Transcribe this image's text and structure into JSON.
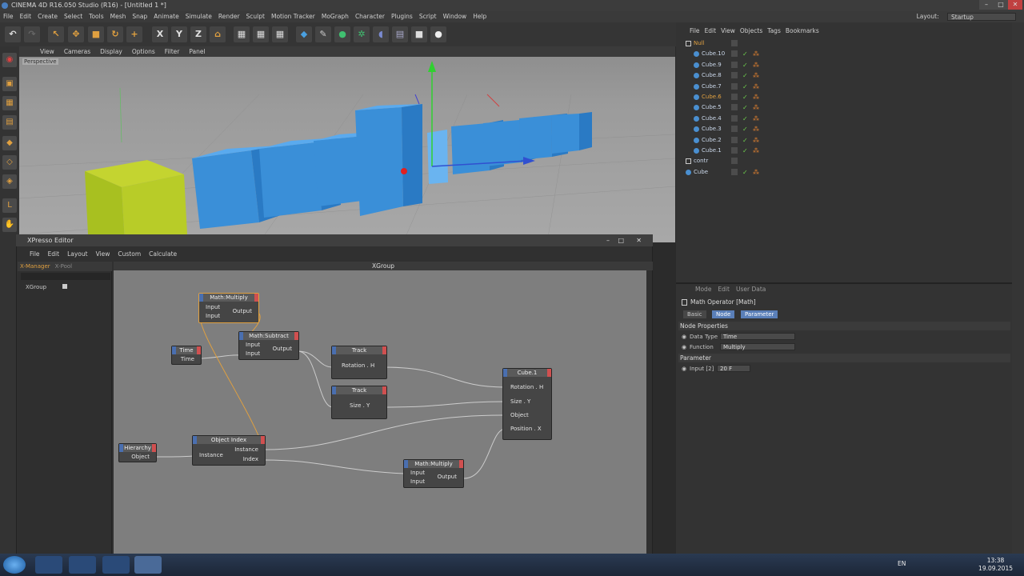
{
  "window": {
    "title": "CINEMA 4D R16.050 Studio (R16) - [Untitled 1 *]"
  },
  "menubar": [
    "File",
    "Edit",
    "Create",
    "Select",
    "Tools",
    "Mesh",
    "Snap",
    "Animate",
    "Simulate",
    "Render",
    "Sculpt",
    "Motion Tracker",
    "MoGraph",
    "Character",
    "Plugins",
    "Script",
    "Window",
    "Help"
  ],
  "layout": {
    "label": "Layout:",
    "value": "Startup"
  },
  "viewport": {
    "menu": [
      "View",
      "Cameras",
      "Display",
      "Options",
      "Filter",
      "Panel"
    ],
    "label": "Perspective"
  },
  "xpresso": {
    "title": "XPresso Editor",
    "menu": [
      "File",
      "Edit",
      "Layout",
      "View",
      "Custom",
      "Calculate"
    ],
    "tabs": [
      "X-Manager",
      "X-Pool"
    ],
    "tree_item": "XGroup",
    "canvas_title": "XGroup",
    "nodes": {
      "mm1": {
        "title": "Math:Multiply",
        "in": [
          "Input",
          "Input"
        ],
        "out": [
          "Output"
        ]
      },
      "msub": {
        "title": "Math:Subtract",
        "in": [
          "Input",
          "Input"
        ],
        "out": [
          "Output"
        ]
      },
      "time": {
        "title": "Time",
        "out": [
          "Time"
        ]
      },
      "track1": {
        "title": "Track",
        "port": "Rotation . H"
      },
      "track2": {
        "title": "Track",
        "port": "Size . Y"
      },
      "cube": {
        "title": "Cube.1",
        "in": [
          "Rotation . H",
          "Size . Y",
          "Object",
          "Position . X"
        ]
      },
      "hier": {
        "title": "Hierarchy",
        "out": [
          "Object"
        ]
      },
      "objidx": {
        "title": "Object Index",
        "in": [
          "Instance"
        ],
        "out": [
          "Instance",
          "Index"
        ]
      },
      "mm2": {
        "title": "Math:Multiply",
        "in": [
          "Input",
          "Input"
        ],
        "out": [
          "Output"
        ]
      }
    }
  },
  "objects": {
    "menu": [
      "File",
      "Edit",
      "View",
      "Objects",
      "Tags",
      "Bookmarks"
    ],
    "items": [
      "Null",
      "Cube.10",
      "Cube.9",
      "Cube.8",
      "Cube.7",
      "Cube.6",
      "Cube.5",
      "Cube.4",
      "Cube.3",
      "Cube.2",
      "Cube.1",
      "contr",
      "Cube"
    ]
  },
  "attributes": {
    "menu": [
      "Mode",
      "Edit",
      "User Data"
    ],
    "title": "Math Operator [Math]",
    "tabs": [
      "Basic",
      "Node",
      "Parameter"
    ],
    "section_node": "Node Properties",
    "data_type_label": "Data Type",
    "data_type_value": "Time",
    "function_label": "Function",
    "function_value": "Multiply",
    "section_param": "Parameter",
    "input_label": "Input [2]",
    "input_value": "20 F"
  },
  "taskbar": {
    "lang": "EN",
    "time": "13:38",
    "date": "19.09.2015"
  },
  "colors": {
    "accent": "#e0a040",
    "cube_blue": "#3a8fd8",
    "cube_yellow": "#a8c020",
    "node_header": "#5a5a5a"
  }
}
